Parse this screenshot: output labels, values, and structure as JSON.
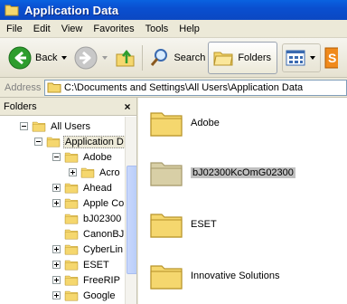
{
  "window": {
    "title": "Application Data"
  },
  "menu": {
    "items": [
      "File",
      "Edit",
      "View",
      "Favorites",
      "Tools",
      "Help"
    ]
  },
  "toolbar": {
    "back_label": "Back",
    "search_label": "Search",
    "folders_label": "Folders"
  },
  "address": {
    "label": "Address",
    "value": "C:\\Documents and Settings\\All Users\\Application Data"
  },
  "folders_pane": {
    "title": "Folders",
    "close_glyph": "×",
    "tree": [
      {
        "label": "All Users",
        "level": 0,
        "expander": "minus"
      },
      {
        "label": "Application D",
        "level": 1,
        "expander": "minus",
        "selected": true
      },
      {
        "label": "Adobe",
        "level": 2,
        "expander": "minus"
      },
      {
        "label": "Acro",
        "level": 3,
        "expander": "plus"
      },
      {
        "label": "Ahead",
        "level": 2,
        "expander": "plus"
      },
      {
        "label": "Apple Co",
        "level": 2,
        "expander": "plus"
      },
      {
        "label": "bJ02300",
        "level": 2,
        "expander": "none"
      },
      {
        "label": "CanonBJ",
        "level": 2,
        "expander": "none"
      },
      {
        "label": "CyberLin",
        "level": 2,
        "expander": "plus"
      },
      {
        "label": "ESET",
        "level": 2,
        "expander": "plus"
      },
      {
        "label": "FreeRIP",
        "level": 2,
        "expander": "plus"
      },
      {
        "label": "Google",
        "level": 2,
        "expander": "plus"
      }
    ]
  },
  "content": {
    "items": [
      {
        "label": "Adobe",
        "selected": false,
        "faded": false
      },
      {
        "label": "bJ02300KcOmG02300",
        "selected": true,
        "faded": true
      },
      {
        "label": "ESET",
        "selected": false,
        "faded": false
      },
      {
        "label": "Innovative Solutions",
        "selected": false,
        "faded": false
      }
    ]
  },
  "colors": {
    "titlebar": "#0a4fd0",
    "folder_fill": "#f5d76e",
    "folder_faded": "#d8cfa6",
    "back_green": "#2e9d2e"
  }
}
